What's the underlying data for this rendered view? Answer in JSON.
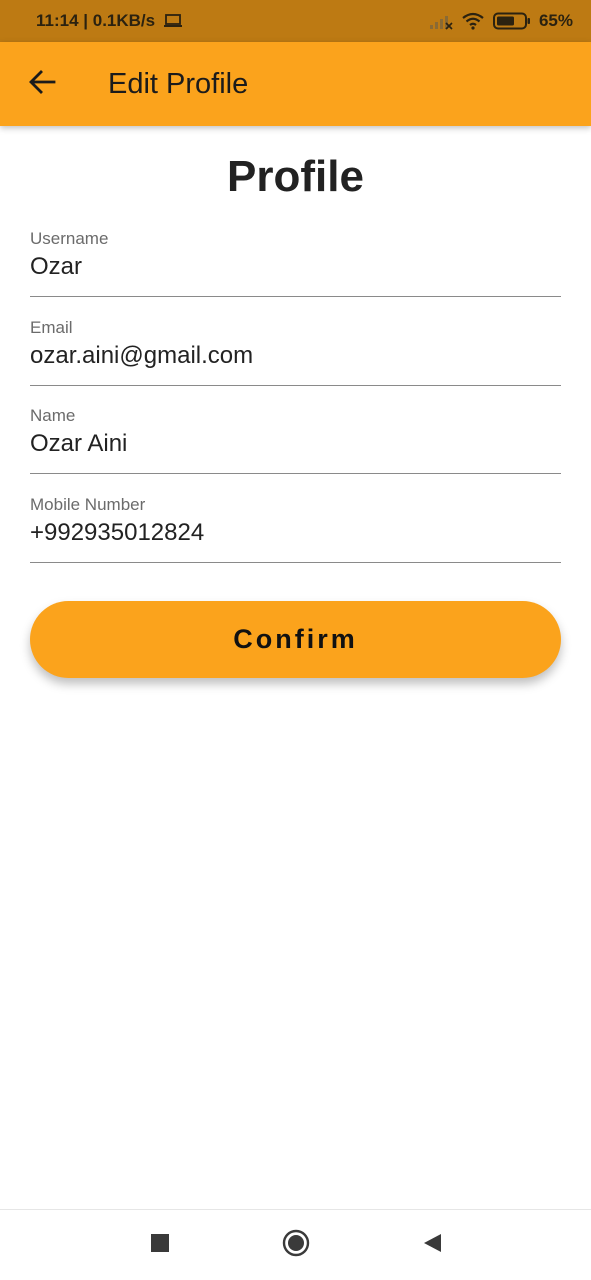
{
  "status_bar": {
    "time_speed": "11:14 | 0.1KB/s",
    "battery": "65%",
    "icons": [
      "laptop-icon",
      "signal-icon",
      "wifi-icon",
      "battery-icon"
    ],
    "battery_level": 0.65
  },
  "app_bar": {
    "title": "Edit Profile",
    "back_icon": "arrow-left-icon"
  },
  "page": {
    "title": "Profile"
  },
  "form": {
    "username": {
      "label": "Username",
      "value": "Ozar"
    },
    "email": {
      "label": "Email",
      "value": "ozar.aini@gmail.com"
    },
    "name": {
      "label": "Name",
      "value": "Ozar Aini"
    },
    "mobile": {
      "label": "Mobile Number",
      "value": "+992935012824"
    }
  },
  "confirm_label": "Confirm",
  "nav": {
    "icons": [
      "recents-icon",
      "home-icon",
      "back-icon"
    ]
  },
  "colors": {
    "accent": "#FBA31C",
    "status_bar": "#BD7A13"
  }
}
